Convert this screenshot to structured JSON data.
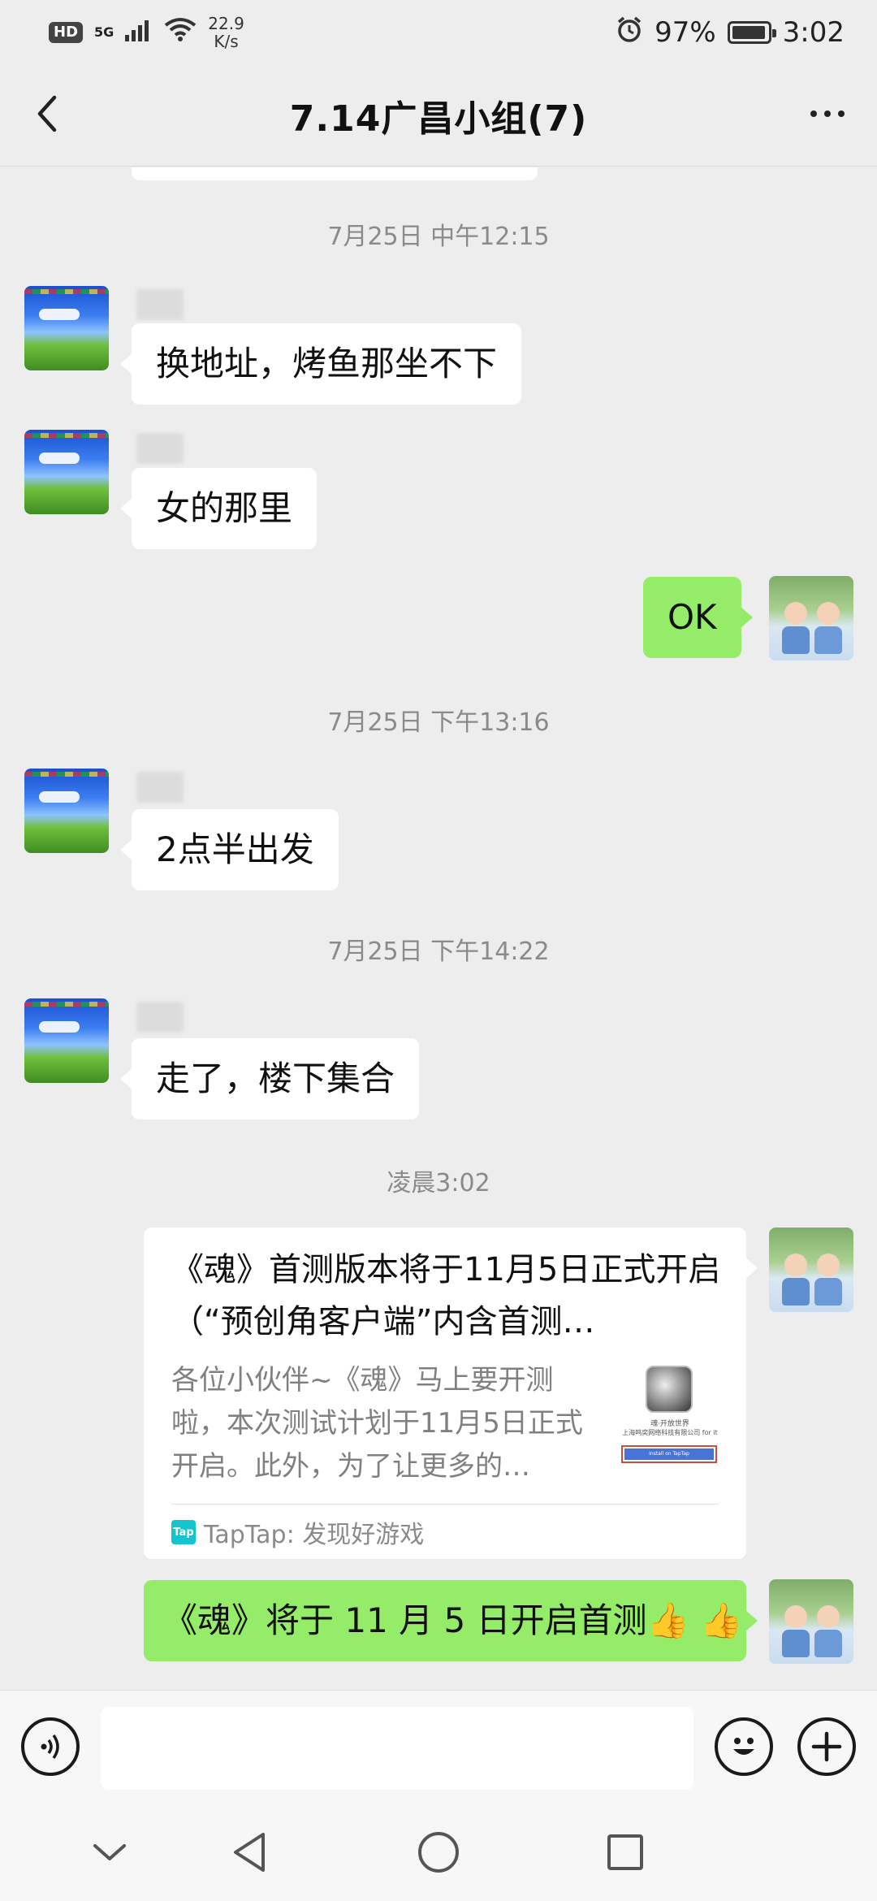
{
  "status_bar": {
    "hd": "HD",
    "network": "5G",
    "speed_value": "22.9",
    "speed_unit": "K/s",
    "battery": "97%",
    "battery_level": 0.97,
    "time": "3:02"
  },
  "header": {
    "title": "7.14广昌小组(7)"
  },
  "chat": {
    "timestamps": [
      "7月25日 中午12:15",
      "7月25日 下午13:16",
      "7月25日 下午14:22",
      "凌晨3:02"
    ],
    "messages": [
      {
        "side": "left",
        "text": "换地址，烤鱼那坐不下"
      },
      {
        "side": "left",
        "text": "女的那里"
      },
      {
        "side": "right",
        "text": "OK"
      },
      {
        "side": "left",
        "text": "2点半出发"
      },
      {
        "side": "left",
        "text": "走了，楼下集合"
      },
      {
        "side": "right",
        "text": "《魂》将于 11 月 5 日开启首测👍 👍"
      }
    ],
    "link_card": {
      "title": "《魂》首测版本将于11月5日正式开启（“预创角客户端”内含首测…",
      "description": "各位小伙伴~《魂》马上要开测啦，本次测试计划于11月5日正式开启。此外，为了让更多的…",
      "thumb_line1": "魂·开放世界",
      "thumb_line2": "上海鸣奕网络科技有限公司 for it",
      "thumb_button": "Install on TapTap",
      "source_icon": "Tap",
      "source": "TapTap: 发现好游戏"
    }
  },
  "input": {
    "value": "",
    "placeholder": ""
  },
  "colors": {
    "background": "#ededed",
    "bubble_green": "#95ec69",
    "bubble_white": "#ffffff",
    "timestamp": "#8a8a8a"
  },
  "icons": {
    "back": "chevron-left-icon",
    "more": "more-dots-icon",
    "voice": "voice-icon",
    "emoji": "emoji-icon",
    "plus": "plus-icon",
    "nav_down": "chevron-down-icon",
    "nav_back": "triangle-back-icon",
    "nav_home": "circle-home-icon",
    "nav_recent": "square-recent-icon"
  }
}
